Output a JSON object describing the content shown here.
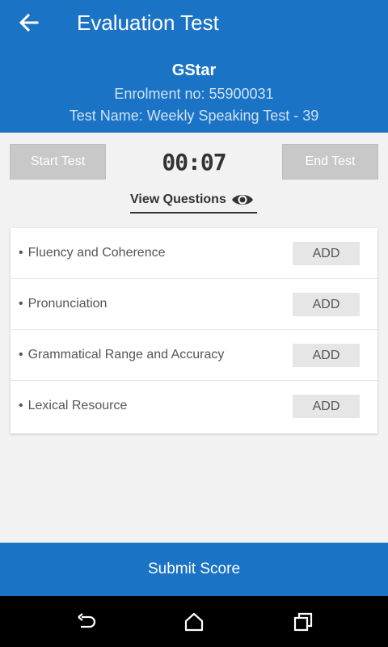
{
  "header": {
    "title": "Evaluation Test",
    "student_name": "GStar",
    "enrolment": "Enrolment no: 55900031",
    "test_name": "Test Name: Weekly Speaking Test - 39"
  },
  "controls": {
    "start_label": "Start Test",
    "timer": "00:07",
    "end_label": "End Test"
  },
  "view_questions": {
    "label": "View Questions"
  },
  "criteria": [
    {
      "label": "Fluency and Coherence",
      "button": "ADD"
    },
    {
      "label": "Pronunciation",
      "button": "ADD"
    },
    {
      "label": "Grammatical Range and Accuracy",
      "button": "ADD"
    },
    {
      "label": "Lexical Resource",
      "button": "ADD"
    }
  ],
  "footer": {
    "submit_label": "Submit Score"
  },
  "icons": {
    "back": "arrow-back-icon",
    "eye": "eye-icon",
    "nav_back": "nav-back-icon",
    "nav_home": "nav-home-icon",
    "nav_recent": "nav-recent-icon"
  },
  "colors": {
    "primary": "#1a73c4",
    "disabled_button": "#c8c8c8",
    "add_button": "#e6e6e6"
  }
}
